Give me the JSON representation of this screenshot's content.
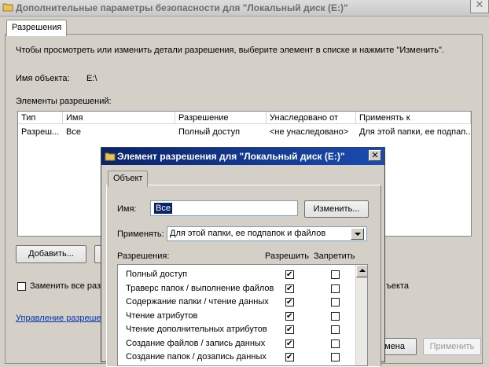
{
  "main_window": {
    "title": "Дополнительные параметры безопасности  для \"Локальный диск (E:)\"",
    "close_glyph": "✕",
    "tab": "Разрешения",
    "instruction": "Чтобы просмотреть или изменить детали разрешения, выберите элемент в списке и нажмите \"Изменить\".",
    "object_name_label": "Имя объекта:",
    "object_name_value": "E:\\",
    "perm_entries_label": "Элементы разрешений:",
    "columns": [
      "Тип",
      "Имя",
      "Разрешение",
      "Унаследовано от",
      "Применять к"
    ],
    "rows": [
      {
        "type": "Разреш...",
        "name": "Все",
        "permission": "Полный доступ",
        "inherited": "<не унаследовано>",
        "apply_to": "Для этой папки, ее подпап..."
      }
    ],
    "add_button": "Добавить...",
    "replace_checkbox_text_left": "Заменить все разр",
    "replace_checkbox_text_right": "ъекта",
    "manage_link": "Управление разреше",
    "cancel_button_partial": "мена",
    "apply_button": "Применить"
  },
  "dialog": {
    "title": "Элемент разрешения для \"Локальный диск (E:)\"",
    "close_glyph": "✕",
    "tab": "Объект",
    "name_label": "Имя:",
    "name_value": "Все",
    "change_button": "Изменить...",
    "apply_label": "Применять:",
    "apply_value": "Для этой папки, ее подпапок и файлов",
    "permissions_label": "Разрешения:",
    "allow_header": "Разрешить",
    "deny_header": "Запретить",
    "permissions": [
      {
        "label": "Полный доступ",
        "allow": true,
        "deny": false
      },
      {
        "label": "Траверс папок / выполнение файлов",
        "allow": true,
        "deny": false
      },
      {
        "label": "Содержание папки / чтение данных",
        "allow": true,
        "deny": false
      },
      {
        "label": "Чтение атрибутов",
        "allow": true,
        "deny": false
      },
      {
        "label": "Чтение дополнительных атрибутов",
        "allow": true,
        "deny": false
      },
      {
        "label": "Создание файлов / запись данных",
        "allow": true,
        "deny": false
      },
      {
        "label": "Создание папок / дозапись данных",
        "allow": true,
        "deny": false
      }
    ]
  }
}
